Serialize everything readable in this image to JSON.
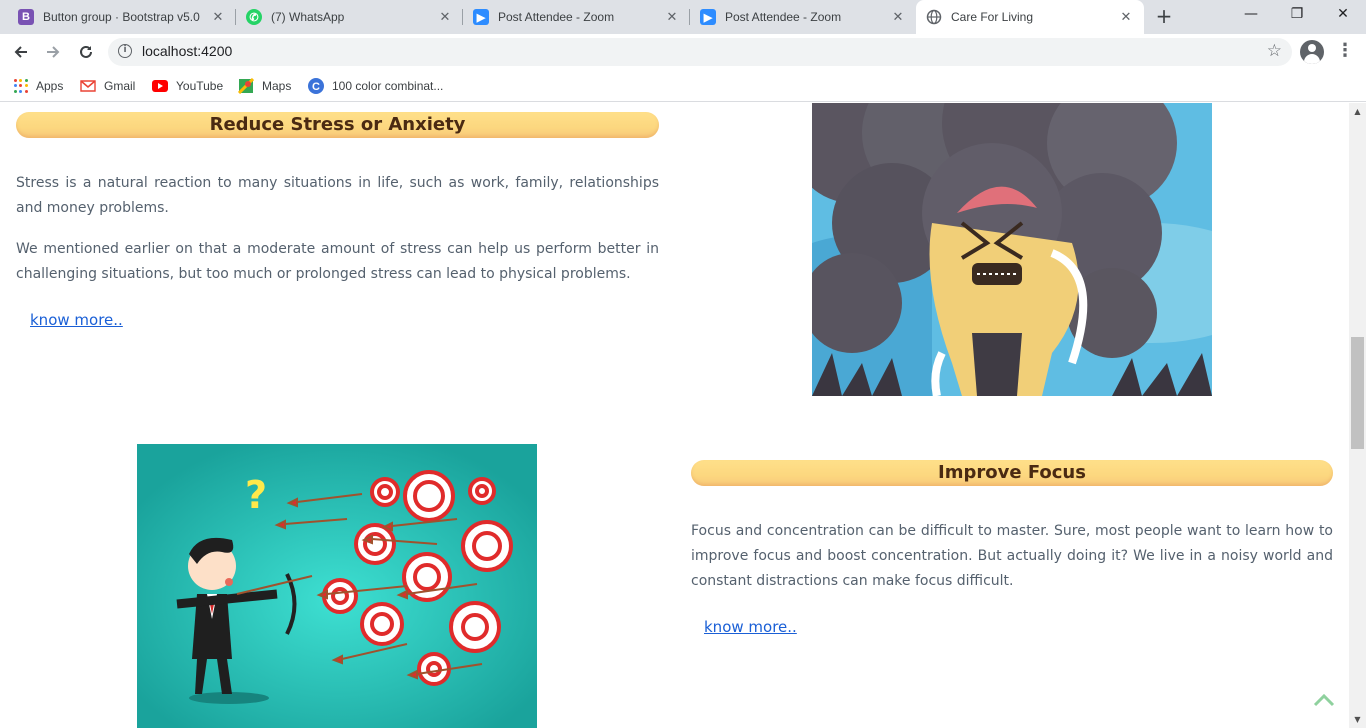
{
  "browser": {
    "tabs": [
      {
        "title": "Button group · Bootstrap v5.0",
        "favicon": "bootstrap-icon",
        "color": "#7952b3"
      },
      {
        "title": "(7) WhatsApp",
        "favicon": "whatsapp-icon",
        "color": "#25d366"
      },
      {
        "title": "Post Attendee - Zoom",
        "favicon": "zoom-icon",
        "color": "#2d8cff"
      },
      {
        "title": "Post Attendee - Zoom",
        "favicon": "zoom-icon",
        "color": "#2d8cff"
      },
      {
        "title": "Care For Living",
        "favicon": "globe-icon",
        "color": "#5f6368"
      }
    ],
    "url": "localhost:4200",
    "bookmarks": [
      {
        "label": "Apps",
        "icon": "apps-grid-icon"
      },
      {
        "label": "Gmail",
        "icon": "gmail-icon"
      },
      {
        "label": "YouTube",
        "icon": "youtube-icon"
      },
      {
        "label": "Maps",
        "icon": "maps-icon"
      },
      {
        "label": "100 color combinat...",
        "icon": "c-logo-icon"
      }
    ]
  },
  "content": {
    "stress": {
      "title": "Reduce Stress or Anxiety",
      "para1": "Stress is a natural reaction to many situations in life, such as work, family, relationships and money problems.",
      "para2": "We mentioned earlier on that a moderate amount of stress can help us perform better in challenging situations, but too much or prolonged stress can lead to physical problems.",
      "link": "know more.."
    },
    "focus": {
      "title": "Improve Focus",
      "para1": "Focus and concentration can be difficult to master. Sure, most people want to learn how to improve focus and boost concentration. But actually doing it? We live in a noisy world and constant distractions can make focus difficult.",
      "link": "know more.."
    }
  },
  "colors": {
    "accent_title_bg": "#fcd77f",
    "title_text": "#4a2a12",
    "link": "#1a5fd6",
    "body_text": "#55616e",
    "scroll_top_arrow": "#8fd19e"
  }
}
